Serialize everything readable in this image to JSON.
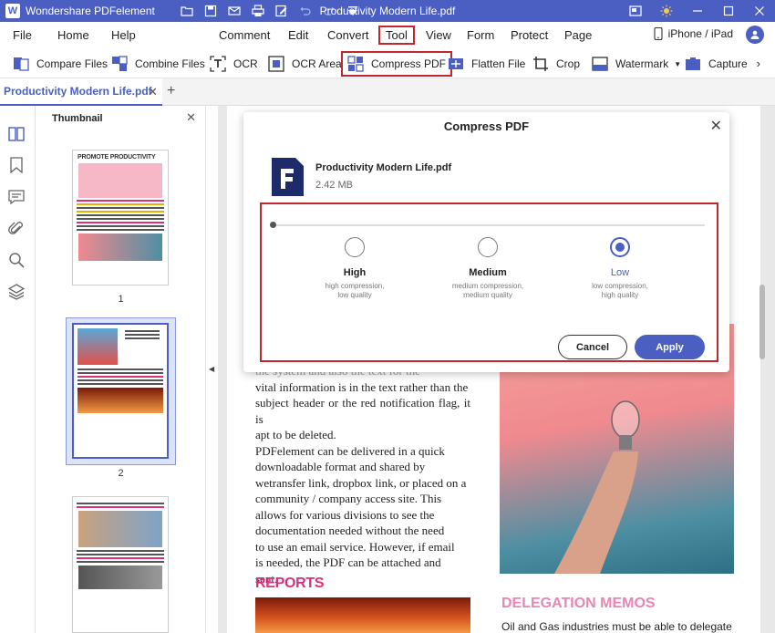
{
  "app": {
    "name": "Wondershare PDFelement",
    "document_title": "Productivity Modern Life.pdf"
  },
  "menu": {
    "file": "File",
    "home": "Home",
    "help": "Help",
    "comment": "Comment",
    "edit": "Edit",
    "convert": "Convert",
    "tool": "Tool",
    "view": "View",
    "form": "Form",
    "protect": "Protect",
    "page": "Page",
    "device": "iPhone / iPad"
  },
  "toolbar": {
    "compare_files": "Compare Files",
    "combine_files": "Combine Files",
    "ocr": "OCR",
    "ocr_area": "OCR Area",
    "compress_pdf": "Compress PDF",
    "flatten_file": "Flatten File",
    "crop": "Crop",
    "watermark": "Watermark",
    "capture": "Capture"
  },
  "tab": {
    "label": "Productivity Modern Life.pdf"
  },
  "thumbnails": {
    "title": "Thumbnail",
    "page1_heading": "PROMOTE PRODUCTIVITY",
    "pages": [
      "1",
      "2"
    ]
  },
  "document": {
    "partial_line": "the system and also the text for the",
    "lines": [
      "vital information is in the text rather than the",
      "subject header or the red notification flag, it is",
      "apt to be deleted.",
      "PDFelement can be delivered in a quick",
      "downloadable format and shared by",
      "wetransfer link, dropbox link, or placed on a",
      "community / company access site. This",
      "allows for various divisions to see the",
      "documentation needed without the need",
      "to use an email service. However, if email",
      "is needed, the PDF can be attached and",
      "sent."
    ],
    "reports_heading": "REPORTS",
    "delegation_heading": "DELEGATION MEMOS",
    "oil_gas_line": "Oil and Gas industries must be able to delegate"
  },
  "dialog": {
    "title": "Compress PDF",
    "file_name": "Productivity Modern Life.pdf",
    "file_size": "2.42 MB",
    "options": [
      {
        "label": "High",
        "desc1": "high compression,",
        "desc2": "low quality",
        "selected": false
      },
      {
        "label": "Medium",
        "desc1": "medium compression,",
        "desc2": "medium quality",
        "selected": false
      },
      {
        "label": "Low",
        "desc1": "low compression,",
        "desc2": "high quality",
        "selected": true
      }
    ],
    "cancel": "Cancel",
    "apply": "Apply"
  },
  "colors": {
    "accent": "#4a5fc1",
    "highlight_box": "#c1272d",
    "heading_pink": "#d8307a"
  }
}
